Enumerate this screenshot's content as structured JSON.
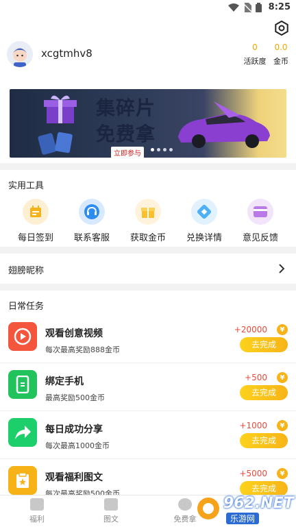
{
  "status_bar": {
    "time": "8:25"
  },
  "profile": {
    "username": "xcgtmhv8",
    "activity_value": "0",
    "activity_label": "活跃度",
    "coins_value": "0.0",
    "coins_label": "金币"
  },
  "banner": {
    "title_line1": "集碎片",
    "title_line2": "免费拿",
    "cta": "立即参与",
    "active_dot_index": 0
  },
  "tools": {
    "title": "实用工具",
    "items": [
      {
        "label": "每日签到",
        "icon": "calendar-icon",
        "color": "#f6b21b"
      },
      {
        "label": "联系客服",
        "icon": "headset-icon",
        "color": "#2d8cf0"
      },
      {
        "label": "获取金币",
        "icon": "gift-icon",
        "color": "#fbbf2b"
      },
      {
        "label": "兑换详情",
        "icon": "diamond-icon",
        "color": "#4fb0f5"
      },
      {
        "label": "意见反馈",
        "icon": "card-icon",
        "color": "#b97ae8"
      }
    ]
  },
  "nickname": {
    "label": "翅膀昵称"
  },
  "tasks": {
    "title": "日常任务",
    "items": [
      {
        "name": "观看创意视频",
        "desc": "每次最高奖励888金币",
        "reward": "+20000",
        "button": "去完成",
        "icon": "play-icon",
        "color": "#f4553d"
      },
      {
        "name": "绑定手机",
        "desc": "最高奖励500金币",
        "reward": "+500",
        "button": "去完成",
        "icon": "phone-icon",
        "color": "#22c35c"
      },
      {
        "name": "每日成功分享",
        "desc": "每次最高1000金币",
        "reward": "+1000",
        "button": "去完成",
        "icon": "share-icon",
        "color": "#1dcf6a"
      },
      {
        "name": "观看福利图文",
        "desc": "每次最高奖励500金币",
        "reward": "+5000",
        "button": "去完成",
        "icon": "article-icon",
        "color": "#f7b218"
      }
    ],
    "coin_glyph": "¥"
  },
  "tabbar": {
    "items": [
      {
        "label": "福利",
        "icon": "gift-tab-icon"
      },
      {
        "label": "图文",
        "icon": "article-tab-icon"
      },
      {
        "label": "免费拿",
        "icon": "free-tab-icon"
      }
    ]
  },
  "watermark": {
    "brand": "962.NET",
    "sub": "乐游网"
  }
}
